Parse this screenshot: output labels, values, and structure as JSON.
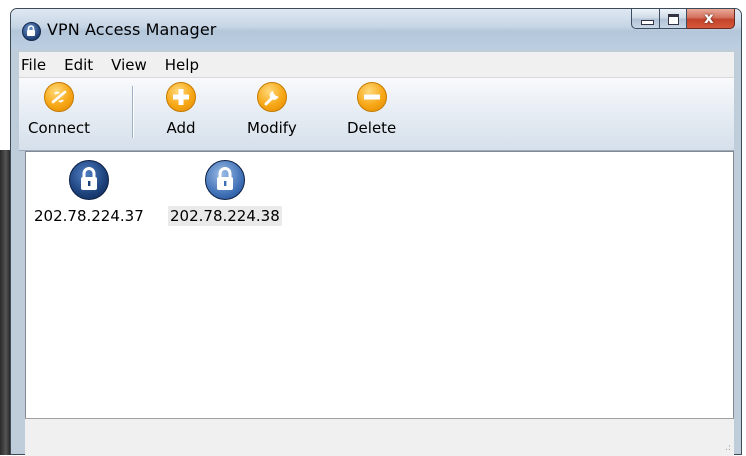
{
  "window": {
    "title": "VPN Access Manager",
    "close_glyph": "x"
  },
  "menu": [
    {
      "label": "File"
    },
    {
      "label": "Edit"
    },
    {
      "label": "View"
    },
    {
      "label": "Help"
    }
  ],
  "toolbar": {
    "buttons": [
      {
        "label": "Connect",
        "icon": "connect-icon"
      },
      {
        "label": "Add",
        "icon": "plus-icon"
      },
      {
        "label": "Modify",
        "icon": "wrench-icon"
      },
      {
        "label": "Delete",
        "icon": "minus-icon"
      }
    ]
  },
  "connections": [
    {
      "label": "202.78.224.37",
      "icon": "lock-icon",
      "selected": false
    },
    {
      "label": "202.78.224.38",
      "icon": "lock-icon",
      "selected": true
    }
  ],
  "status": {
    "grip_glyph": ".:"
  },
  "colors": {
    "accent": "#f7a716",
    "lock_blue": "#1b3f78",
    "close_red": "#c2432a"
  }
}
